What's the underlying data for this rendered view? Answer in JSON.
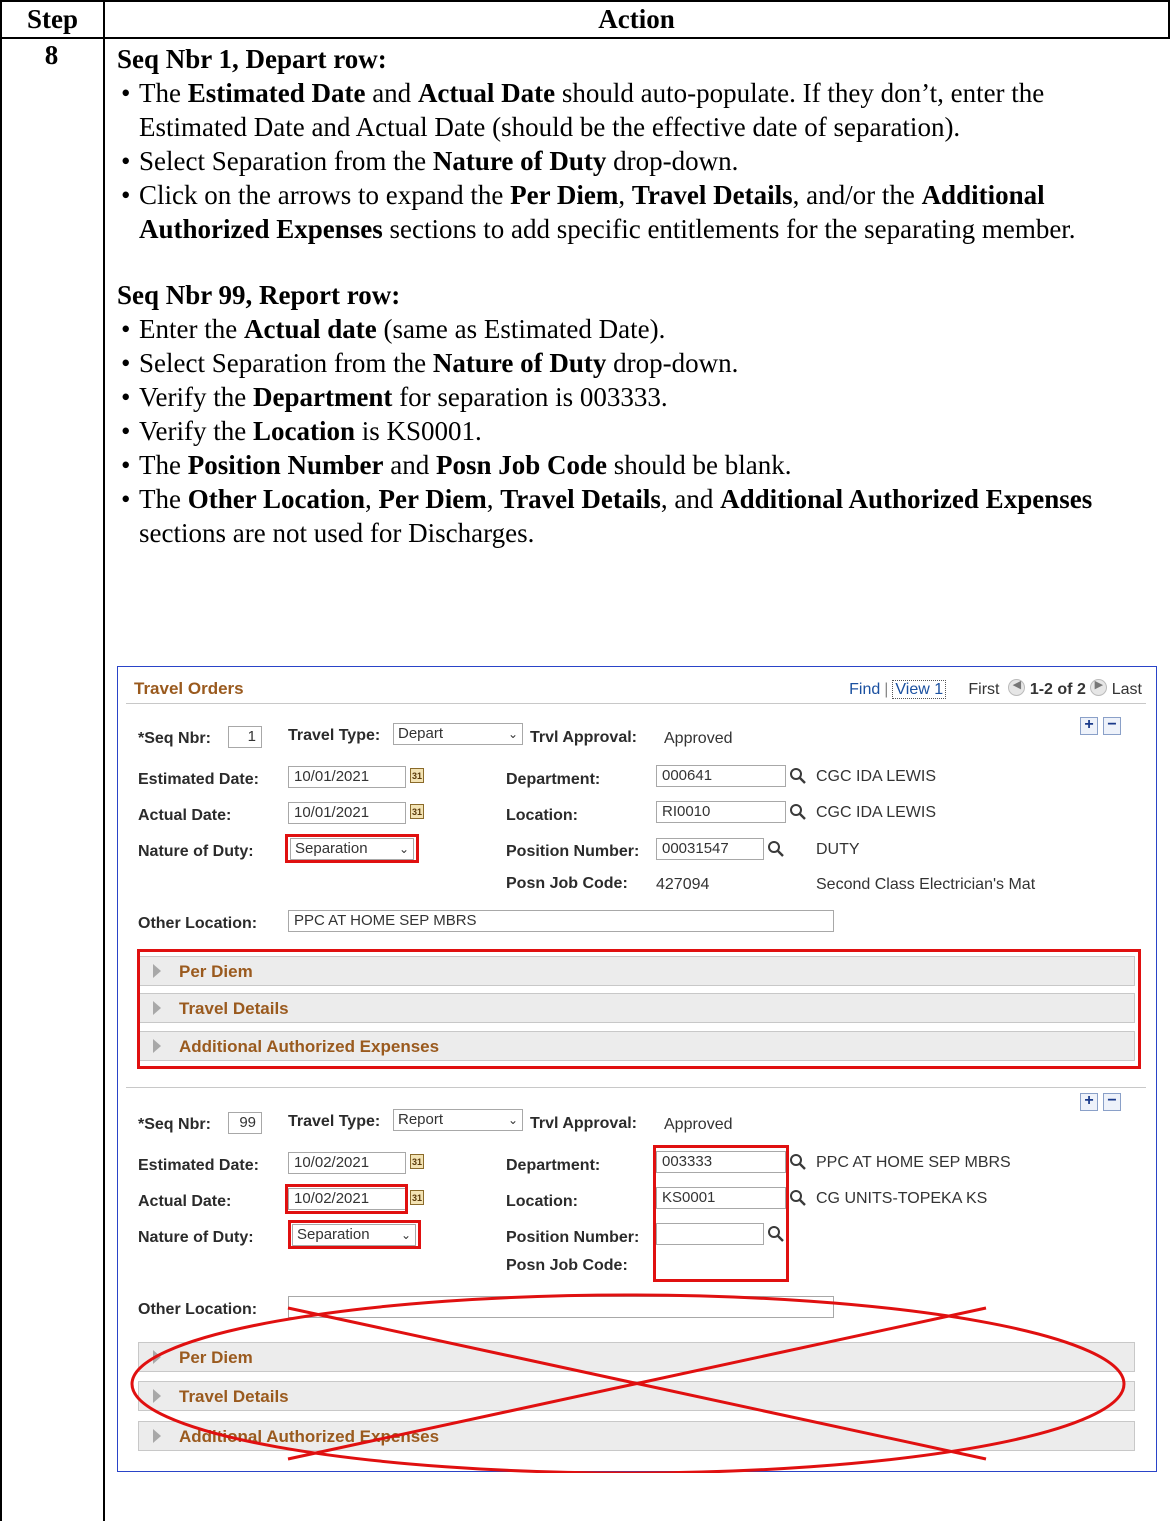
{
  "table": {
    "col_step": "Step",
    "col_action": "Action",
    "step_number": "8"
  },
  "section1": {
    "heading": "Seq Nbr 1, Depart row:",
    "bullets": [
      [
        "The ",
        {
          "b": "Estimated Date"
        },
        " and ",
        {
          "b": "Actual Date"
        },
        " should auto-populate.  If they don’t, enter the Estimated Date and Actual Date (should be the effective date of separation)."
      ],
      [
        "Select Separation from the ",
        {
          "b": "Nature of Duty"
        },
        " drop-down."
      ],
      [
        "Click on the arrows to expand the ",
        {
          "b": "Per Diem"
        },
        ", ",
        {
          "b": "Travel Details"
        },
        ", and/or the ",
        {
          "b": "Additional Authorized Expenses"
        },
        " sections to add specific entitlements for the separating member."
      ]
    ]
  },
  "section2": {
    "heading": "Seq Nbr 99, Report row:",
    "bullets": [
      [
        "Enter the ",
        {
          "b": "Actual date"
        },
        " (same as Estimated Date)."
      ],
      [
        "Select Separation from the ",
        {
          "b": "Nature of Duty"
        },
        " drop-down."
      ],
      [
        "Verify the ",
        {
          "b": "Department"
        },
        " for separation is 003333."
      ],
      [
        "Verify the ",
        {
          "b": "Location"
        },
        " is KS0001."
      ],
      [
        "The ",
        {
          "b": "Position Number"
        },
        " and ",
        {
          "b": "Posn Job Code"
        },
        " should be blank."
      ],
      [
        "The ",
        {
          "b": "Other Location"
        },
        ", ",
        {
          "b": "Per Diem"
        },
        ", ",
        {
          "b": "Travel Details"
        },
        ", and ",
        {
          "b": "Additional Authorized Expenses"
        },
        " sections are not used for Discharges."
      ]
    ]
  },
  "screenshot": {
    "title": "Travel Orders",
    "nav": {
      "find": "Find",
      "view": "View 1",
      "first": "First",
      "count": "1-2 of 2",
      "last": "Last"
    },
    "labels": {
      "seq_nbr": "*Seq Nbr:",
      "travel_type": "Travel Type:",
      "trvl_approval": "Trvl Approval:",
      "estimated_date": "Estimated Date:",
      "actual_date": "Actual Date:",
      "nature_of_duty": "Nature of Duty:",
      "department": "Department:",
      "location": "Location:",
      "position_number": "Position Number:",
      "posn_job_code": "Posn Job Code:",
      "other_location": "Other Location:"
    },
    "rows": [
      {
        "seq_nbr": "1",
        "travel_type": "Depart",
        "trvl_approval": "Approved",
        "estimated_date": "10/01/2021",
        "actual_date": "10/01/2021",
        "nature_of_duty": "Separation",
        "department": "000641",
        "department_desc": "CGC IDA LEWIS",
        "location": "RI0010",
        "location_desc": "CGC IDA LEWIS",
        "position_number": "00031547",
        "position_desc": "DUTY",
        "posn_job_code": "427094",
        "posn_job_desc": "Second Class Electrician's Mat",
        "other_location": "PPC AT HOME SEP MBRS"
      },
      {
        "seq_nbr": "99",
        "travel_type": "Report",
        "trvl_approval": "Approved",
        "estimated_date": "10/02/2021",
        "actual_date": "10/02/2021",
        "nature_of_duty": "Separation",
        "department": "003333",
        "department_desc": "PPC AT HOME SEP MBRS",
        "location": "KS0001",
        "location_desc": "CG UNITS-TOPEKA KS",
        "position_number": "",
        "posn_job_code": "",
        "other_location": ""
      }
    ],
    "sections": [
      "Per Diem",
      "Travel Details",
      "Additional Authorized Expenses"
    ],
    "icons": {
      "calendar": "calendar-icon",
      "lookup": "magnifier-icon",
      "add": "plus-icon",
      "delete": "minus-icon",
      "expand": "triangle-right-icon"
    },
    "colors": {
      "title": "#9a5a1e",
      "highlight": "#e01010",
      "frame": "#2a44c8"
    }
  }
}
